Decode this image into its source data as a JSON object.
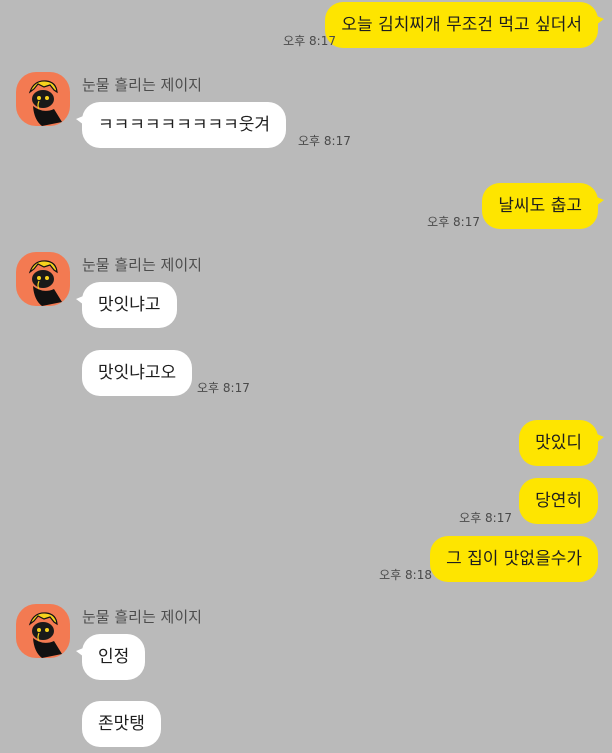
{
  "colors": {
    "background": "#bababa",
    "my_bubble": "#fee500",
    "their_bubble": "#ffffff",
    "avatar_bg": "#f37a52"
  },
  "friend": {
    "name": "눈물 흘리는 제이지",
    "avatar_icon": "crying-cartoon-character-icon"
  },
  "messages": [
    {
      "from": "me",
      "text": "오늘 김치찌개 무조건 먹고 싶더서",
      "time": "오후 8:17"
    },
    {
      "from": "them",
      "text": "ㅋㅋㅋㅋㅋㅋㅋㅋㅋ웃겨",
      "time": "오후 8:17"
    },
    {
      "from": "me",
      "text": "날씨도 춥고",
      "time": "오후 8:17"
    },
    {
      "from": "them",
      "text": "맛잇냐고",
      "time": ""
    },
    {
      "from": "them",
      "text": "맛잇냐고오",
      "time": "오후 8:17"
    },
    {
      "from": "me",
      "text": "맛있디",
      "time": ""
    },
    {
      "from": "me",
      "text": "당연히",
      "time": "오후 8:17"
    },
    {
      "from": "me",
      "text": "그 집이 맛없을수가",
      "time": "오후 8:18"
    },
    {
      "from": "them",
      "text": "인정",
      "time": ""
    },
    {
      "from": "them",
      "text": "존맛탱",
      "time": ""
    }
  ]
}
